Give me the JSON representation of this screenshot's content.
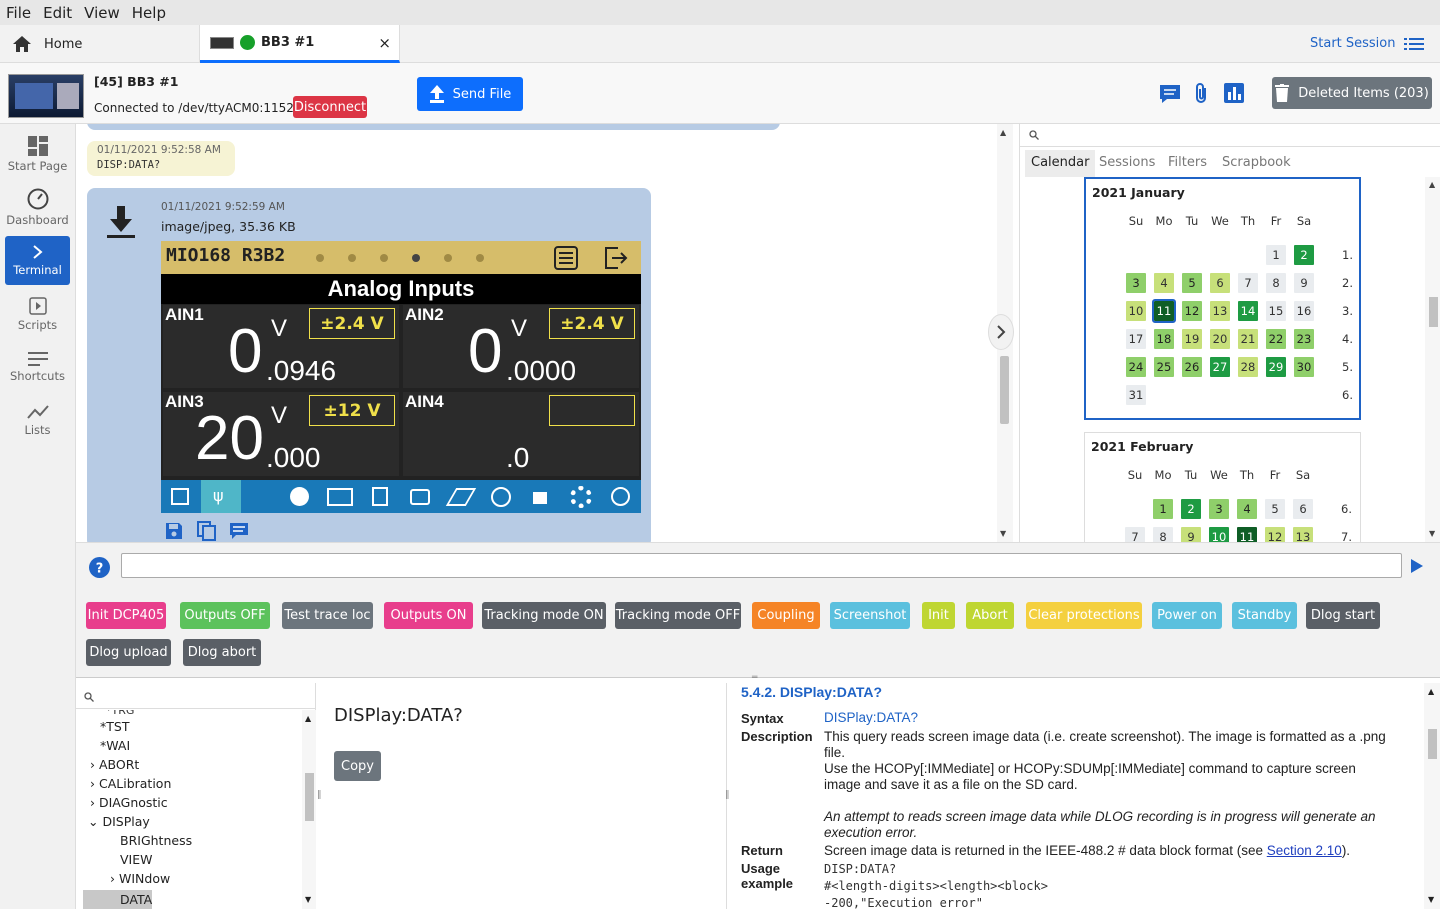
{
  "menu": [
    "File",
    "Edit",
    "View",
    "Help"
  ],
  "tabs": {
    "home": "Home",
    "instrument": "BB3 #1",
    "start_session": "Start Session"
  },
  "header": {
    "title": "[45] BB3 #1",
    "connection": "Connected to /dev/ttyACM0:115200",
    "disconnect": "Disconnect",
    "send_file": "Send File",
    "deleted_items": "Deleted Items (203)"
  },
  "sidebar": [
    {
      "label": "Start Page",
      "icon": "grid-icon"
    },
    {
      "label": "Dashboard",
      "icon": "gauge-icon"
    },
    {
      "label": "Terminal",
      "icon": "chevron-right-icon"
    },
    {
      "label": "Scripts",
      "icon": "play-file-icon"
    },
    {
      "label": "Shortcuts",
      "icon": "lines-icon"
    },
    {
      "label": "Lists",
      "icon": "trend-icon"
    }
  ],
  "terminal": {
    "cmd_time": "01/11/2021 9:52:58 AM",
    "cmd_text": "DISP:DATA?",
    "resp_time": "01/11/2021 9:52:59 AM",
    "resp_type": "image/jpeg, 35.36 KB"
  },
  "screen": {
    "model": "MIO168 R3B2",
    "title": "Analog Inputs",
    "channels": [
      {
        "name": "AIN1",
        "big": "0",
        "unit": "V",
        "frac": ".0946",
        "range": "±2.4 V"
      },
      {
        "name": "AIN2",
        "big": "0",
        "unit": "V",
        "frac": ".0000",
        "range": "±2.4 V"
      },
      {
        "name": "AIN3",
        "big": "20",
        "unit": "V",
        "frac": ".000",
        "range": "±12 V"
      },
      {
        "name": "AIN4",
        "big": "",
        "unit": "",
        "frac": ".0",
        "range": ""
      }
    ]
  },
  "right_panel": {
    "tabs": [
      "Calendar",
      "Sessions",
      "Filters",
      "Scrapbook"
    ],
    "jan": {
      "title": "2021 January",
      "weeks": [
        "1.",
        "2.",
        "3.",
        "4.",
        "5.",
        "6."
      ]
    },
    "feb": {
      "title": "2021 February",
      "weeks": [
        "6.",
        "7."
      ]
    },
    "day_names": [
      "Su",
      "Mo",
      "Tu",
      "We",
      "Th",
      "Fr",
      "Sa"
    ]
  },
  "shortcuts": [
    {
      "label": "Init DCP405",
      "color": "#e83e8c"
    },
    {
      "label": "Outputs OFF",
      "color": "#5cc25c"
    },
    {
      "label": "Test trace loc",
      "color": "#6c757d"
    },
    {
      "label": "Outputs ON",
      "color": "#e83e8c"
    },
    {
      "label": "Tracking mode ON",
      "color": "#5a5f66"
    },
    {
      "label": "Tracking mode OFF",
      "color": "#5a5f66"
    },
    {
      "label": "Coupling",
      "color": "#f58426"
    },
    {
      "label": "Screenshot",
      "color": "#5bc0de"
    },
    {
      "label": "Init",
      "color": "#bfd632"
    },
    {
      "label": "Abort",
      "color": "#bfd632"
    },
    {
      "label": "Clear protections",
      "color": "#f4d03f"
    },
    {
      "label": "Power on",
      "color": "#5bc0de"
    },
    {
      "label": "Standby",
      "color": "#5bc0de"
    },
    {
      "label": "Dlog start",
      "color": "#5a5f66"
    },
    {
      "label": "Dlog upload",
      "color": "#5a5f66"
    },
    {
      "label": "Dlog abort",
      "color": "#5a5f66"
    }
  ],
  "help_tree": [
    "*TST",
    "*WAI",
    "ABORt",
    "CALibration",
    "DIAGnostic",
    "DISPlay",
    "BRIGhtness",
    "VIEW",
    "WINdow",
    "DATA"
  ],
  "help_mid": {
    "title": "DISPlay:DATA?",
    "copy": "Copy"
  },
  "help_doc": {
    "heading": "5.4.2. DISPlay:DATA?",
    "syntax_label": "Syntax",
    "syntax": "DISPlay:DATA?",
    "desc_label": "Description",
    "desc1": "This query reads screen image data (i.e. create screenshot). The image is formatted as a .png file.",
    "desc2": "Use the HCOPy[:IMMediate] or HCOPy:SDUMp[:IMMediate] command to capture screen image and save it as a file on the SD card.",
    "desc3": "An attempt to reads screen image data while DLOG recording is in progress will generate an execution error.",
    "return_label": "Return",
    "return_text": "Screen image data is returned in the IEEE-488.2 # data block format (see ",
    "return_link": "Section 2.10",
    "return_end": ").",
    "usage_label": "Usage",
    "example_label": "example",
    "ex1": "DISP:DATA?",
    "ex2": "#<length-digits><length><block>",
    "ex3": "-200,\"Execution error\""
  }
}
